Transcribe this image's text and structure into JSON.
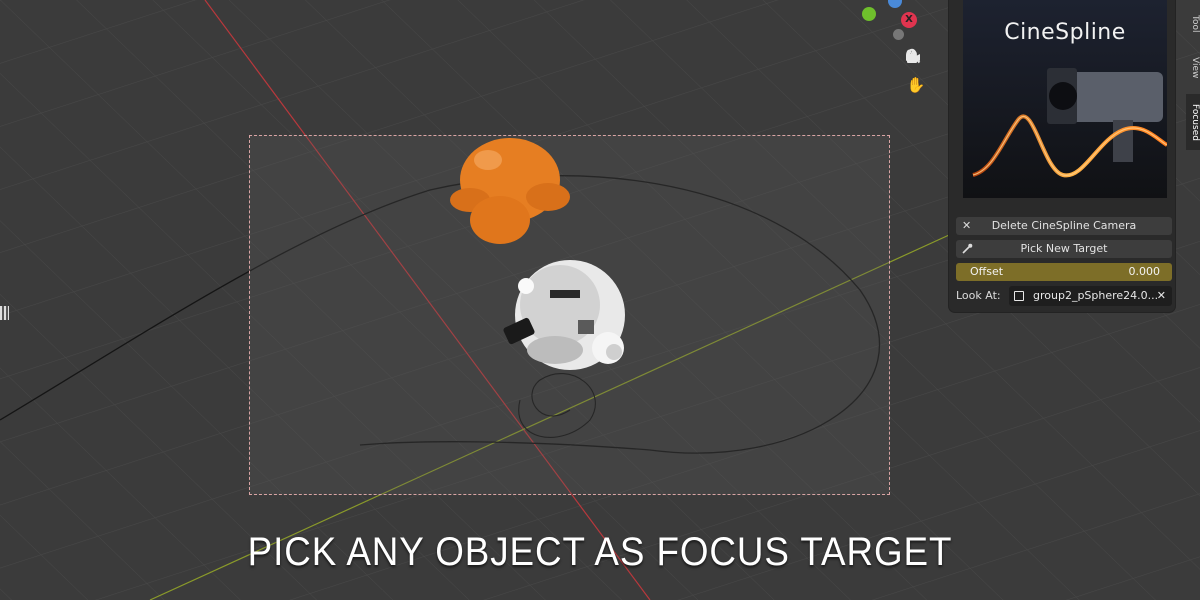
{
  "colors": {
    "axis_x": "#b8383c",
    "axis_y": "#8a9a2a",
    "offset_field": "#7d6e28",
    "orange_object": "#e67e22"
  },
  "viewport": {
    "gizmo": {
      "x_label": "X"
    },
    "nav_icons": [
      "zoom-icon",
      "hand-pan-icon",
      "camera-icon",
      "lock-icon"
    ]
  },
  "panel": {
    "preview_title": "CineSpline",
    "delete_button": "Delete CineSpline Camera",
    "pick_button": "Pick New Target",
    "offset": {
      "label": "Offset",
      "value": "0.000"
    },
    "look_at": {
      "label": "Look At:",
      "value": "group2_pSphere24.0..."
    }
  },
  "side_tabs": [
    "Tool",
    "View",
    "Focused"
  ],
  "caption": "PICK ANY OBJECT AS FOCUS TARGET"
}
